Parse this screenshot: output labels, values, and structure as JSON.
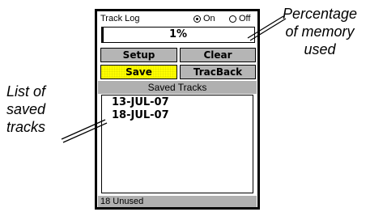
{
  "device": {
    "title": "Track Log",
    "radio_on_label": "On",
    "radio_off_label": "Off",
    "radio_selected": "On",
    "memory_used_text": "1%",
    "memory_used_fraction": 0.01,
    "buttons": {
      "setup": "Setup",
      "clear": "Clear",
      "save": "Save",
      "tracback": "TracBack"
    },
    "saved_tracks_header": "Saved Tracks",
    "saved_tracks": [
      "13-JUL-07",
      "18-JUL-07"
    ],
    "footer": "18 Unused"
  },
  "callouts": {
    "right": [
      "Percentage",
      "of memory",
      "used"
    ],
    "left": [
      "List of",
      "saved",
      "tracks"
    ]
  },
  "colors": {
    "highlight_button": "#ffff00",
    "button_gray": "#b5b5b5",
    "bar_gray": "#b0b0b0"
  }
}
